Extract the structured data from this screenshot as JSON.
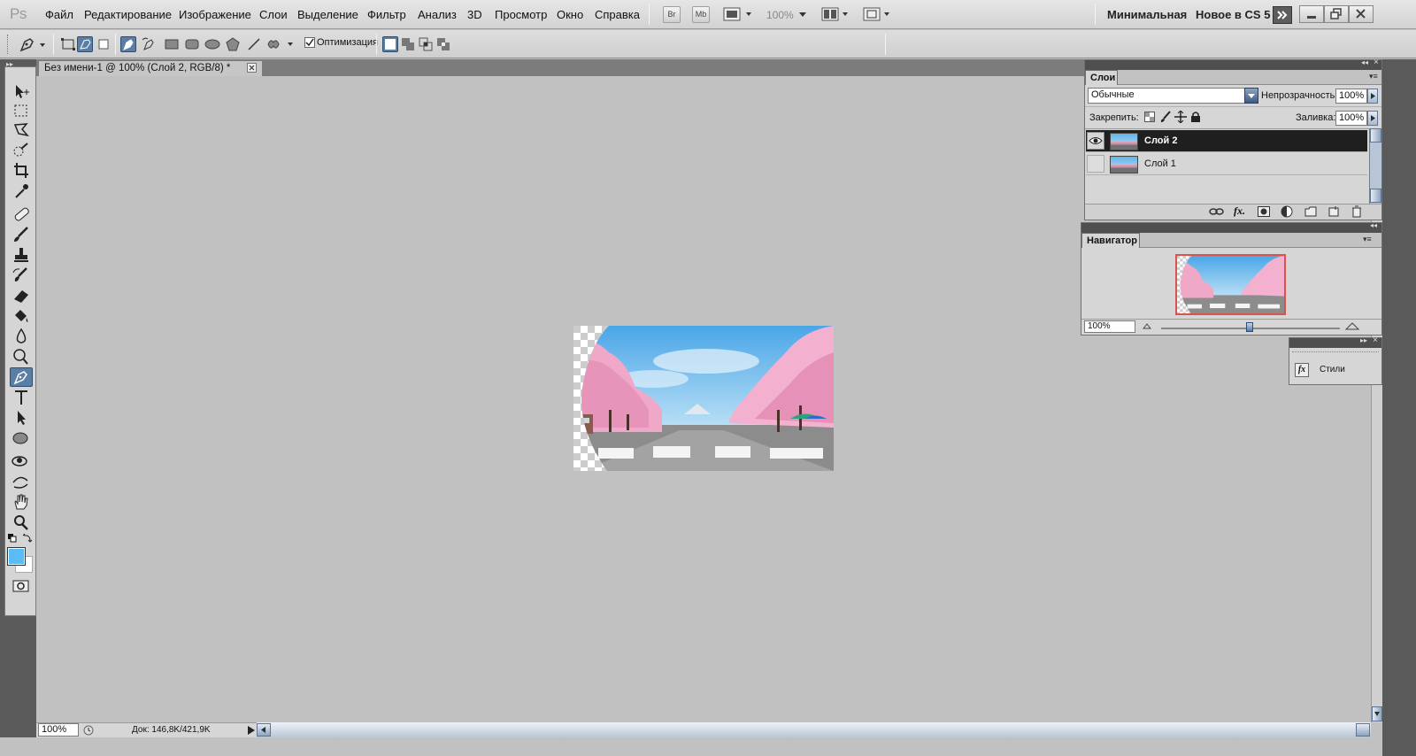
{
  "app": {
    "logo": "Ps"
  },
  "menu": [
    "Файл",
    "Редактирование",
    "Изображение",
    "Слои",
    "Выделение",
    "Фильтр",
    "Анализ",
    "3D",
    "Просмотр",
    "Окно",
    "Справка"
  ],
  "appbar": {
    "br": "Br",
    "mb": "Mb",
    "zoom": "100%"
  },
  "workspaces": {
    "minimal": "Минимальная",
    "new_cs5": "Новое в CS 5"
  },
  "options": {
    "optimization_label": "Оптимизация",
    "optimization_checked": true
  },
  "document": {
    "tab_title": "Без имени-1 @ 100% (Слой 2, RGB/8) *"
  },
  "status": {
    "zoom": "100%",
    "doc_info": "Док: 146,8K/421,9K"
  },
  "colors": {
    "foreground": "#5bbcf3",
    "background": "#ffffff",
    "accent": "#5b7ea5"
  },
  "layers_panel": {
    "tab": "Слои",
    "blend_mode": "Обычные",
    "opacity_label": "Непрозрачность:",
    "opacity_value": "100%",
    "lock_label": "Закрепить:",
    "fill_label": "Заливка:",
    "fill_value": "100%",
    "layers": [
      {
        "name": "Слой 2",
        "visible": true,
        "selected": true
      },
      {
        "name": "Слой 1",
        "visible": false,
        "selected": false
      }
    ]
  },
  "navigator_panel": {
    "tab": "Навигатор",
    "zoom": "100%"
  },
  "styles_panel": {
    "label": "Стили"
  },
  "icons": [
    "pen-tool-icon",
    "move-icon",
    "marquee-icon",
    "lasso-icon",
    "quick-select-icon",
    "crop-icon",
    "eyedropper-icon",
    "healing-icon",
    "brush-icon",
    "stamp-icon",
    "history-brush-icon",
    "eraser-icon",
    "bucket-icon",
    "blur-icon",
    "dodge-icon",
    "pen-icon",
    "type-icon",
    "path-select-icon",
    "ellipse-icon",
    "rotate-3d-icon",
    "orbit-3d-icon",
    "hand-icon",
    "zoom-icon",
    "eye-icon",
    "link-icon",
    "fx-icon",
    "mask-icon",
    "adjustment-icon",
    "folder-icon",
    "new-layer-icon",
    "trash-icon"
  ]
}
